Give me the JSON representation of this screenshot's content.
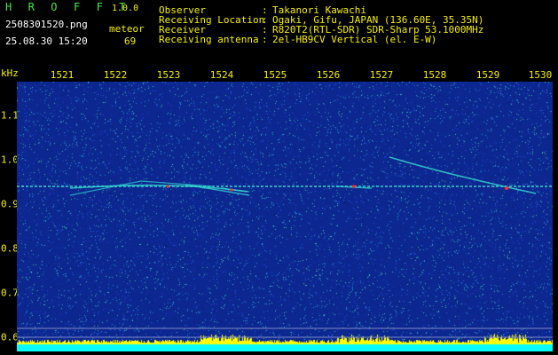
{
  "header": {
    "app_name": "H R O F F T",
    "app_version": "1.0.0",
    "file_name": "2508301520.png",
    "date_time": "25.08.30 15:20",
    "mode_label": "meteor",
    "count_value": "69"
  },
  "station_info": [
    {
      "label": "Observer",
      "value": "Takanori Kawachi"
    },
    {
      "label": "Receiving Location",
      "value": "Ogaki, Gifu, JAPAN (136.60E, 35.35N)"
    },
    {
      "label": "Receiver",
      "value": "R820T2(RTL-SDR) SDR-Sharp 53.1000MHz"
    },
    {
      "label": "Receiving antenna",
      "value": "2el-HB9CV Vertical (el. E-W)"
    }
  ],
  "separator": ":",
  "axes": {
    "y_unit": "kHz",
    "x_ticks": [
      "1521",
      "1522",
      "1523",
      "1524",
      "1525",
      "1526",
      "1527",
      "1528",
      "1529",
      "1530"
    ],
    "y_ticks": [
      "1.1",
      "1.0",
      "0.9",
      "0.8",
      "0.7",
      "0.6"
    ]
  },
  "colors": {
    "background": "#000000",
    "plot_background": "#0d2790",
    "text_yellow": "#f5f000",
    "text_green": "#48e848",
    "echo_cyan": "#35d5d0",
    "echo_red": "#ff2a2a",
    "noise_floor_yellow": "#ffff00",
    "baseline_cyan": "#00ffff"
  }
}
